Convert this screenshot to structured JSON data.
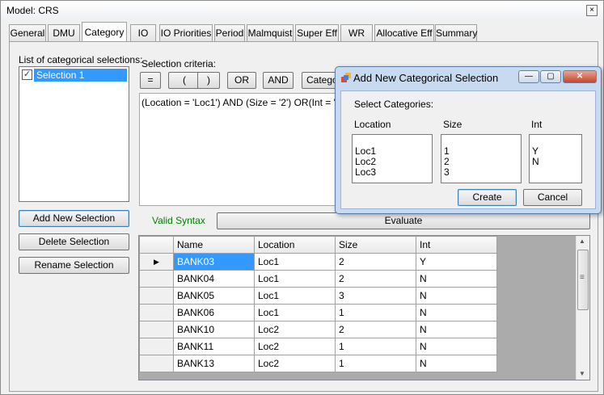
{
  "window": {
    "title": "Model: CRS",
    "close_glyph": "×"
  },
  "tabs": [
    {
      "label": "General"
    },
    {
      "label": "DMU"
    },
    {
      "label": "Category"
    },
    {
      "label": "IO"
    },
    {
      "label": "IO Priorities"
    },
    {
      "label": "Period"
    },
    {
      "label": "Malmquist"
    },
    {
      "label": "Super Eff"
    },
    {
      "label": "WR"
    },
    {
      "label": "Allocative Eff"
    },
    {
      "label": "Summary"
    }
  ],
  "active_tab": "Category",
  "left": {
    "list_label": "List of categorical selections:",
    "selections": [
      {
        "label": "Selection 1",
        "checked": true,
        "check_glyph": "✓"
      }
    ],
    "add_button": "Add New Selection",
    "delete_button": "Delete Selection",
    "rename_button": "Rename Selection"
  },
  "criteria": {
    "label": "Selection criteria:",
    "buttons": [
      "=",
      "(",
      ")",
      "OR",
      "AND",
      "Catego"
    ],
    "expression": "(Location = 'Loc1') AND (Size = '2') OR(Int = 'N')",
    "status": "Valid Syntax",
    "status_color": "#008000",
    "evaluate_button": "Evaluate"
  },
  "grid": {
    "columns": [
      "Name",
      "Location",
      "Size",
      "Int"
    ],
    "current_row_glyph": "▶",
    "rows": [
      [
        "BANK03",
        "Loc1",
        "2",
        "Y"
      ],
      [
        "BANK04",
        "Loc1",
        "2",
        "N"
      ],
      [
        "BANK05",
        "Loc1",
        "3",
        "N"
      ],
      [
        "BANK06",
        "Loc1",
        "1",
        "N"
      ],
      [
        "BANK10",
        "Loc2",
        "2",
        "N"
      ],
      [
        "BANK11",
        "Loc2",
        "1",
        "N"
      ],
      [
        "BANK13",
        "Loc2",
        "1",
        "N"
      ]
    ],
    "scroll_up_glyph": "▲",
    "scroll_down_glyph": "▼",
    "grip_glyph": "≡"
  },
  "dialog": {
    "title": "Add New Categorical Selection",
    "prompt": "Select Categories:",
    "minimize_glyph": "—",
    "maximize_glyph": "▢",
    "close_glyph": "✕",
    "categories": [
      {
        "name": "Location",
        "values": [
          "Loc1",
          "Loc2",
          "Loc3"
        ]
      },
      {
        "name": "Size",
        "values": [
          "1",
          "2",
          "3"
        ]
      },
      {
        "name": "Int",
        "values": [
          "Y",
          "N"
        ]
      }
    ],
    "create_button": "Create",
    "cancel_button": "Cancel"
  },
  "colors": {
    "selection_blue": "#3399ff",
    "dialog_frame": "#c8daf0"
  }
}
